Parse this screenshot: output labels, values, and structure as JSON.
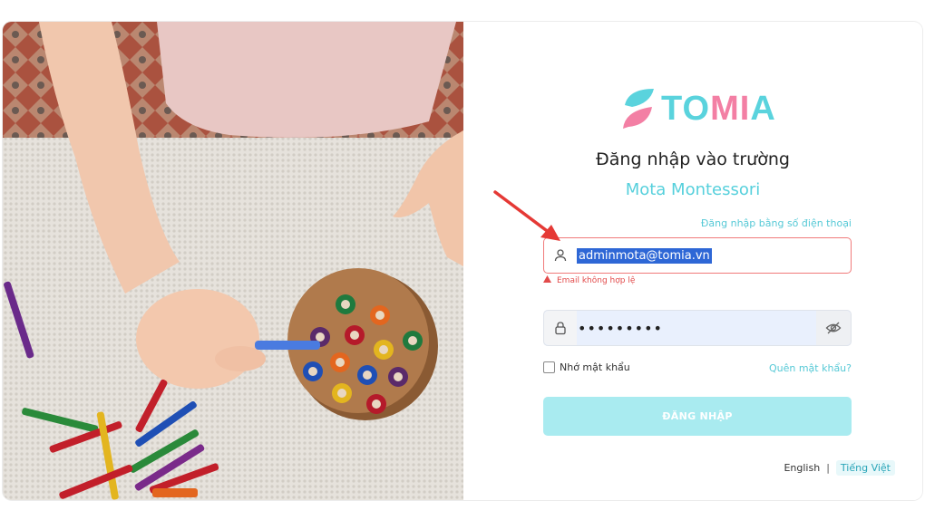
{
  "brand": {
    "logo_part1": "TO",
    "logo_part2": "MI",
    "logo_part3": "A"
  },
  "login": {
    "title": "Đăng nhập vào trường",
    "school_name": "Mota Montessori",
    "phone_login_link": "Đăng nhập bằng số điện thoại",
    "email_value": "adminmota@tomia.vn",
    "email_error": "Email không hợp lệ",
    "password_value": "•••••••••",
    "remember_label": "Nhớ mật khẩu",
    "forgot_link": "Quên mật khẩu?",
    "submit_label": "ĐĂNG NHẬP"
  },
  "language": {
    "options": [
      "English",
      "Tiếng Việt"
    ],
    "separator": "|",
    "selected": "Tiếng Việt"
  },
  "colors": {
    "brand_teal": "#5ad3dd",
    "brand_pink": "#f37fa4",
    "error_red": "#e24b4b",
    "button_bg": "#a9ebf0",
    "annotation_arrow": "#e53935"
  },
  "icons": {
    "email_field": "user-icon",
    "password_field": "lock-icon",
    "password_toggle": "eye-off-icon",
    "error": "warning-icon"
  }
}
